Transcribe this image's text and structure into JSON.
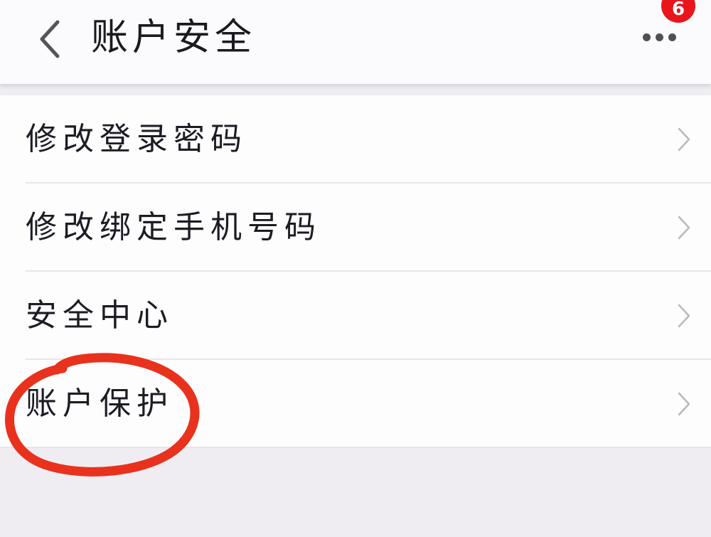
{
  "header": {
    "title": "账户安全",
    "badge_count": "6",
    "back_icon": "chevron-left-icon",
    "more_icon": "more-horizontal-icon"
  },
  "menu": {
    "items": [
      {
        "label": "修改登录密码"
      },
      {
        "label": "修改绑定手机号码"
      },
      {
        "label": "安全中心"
      },
      {
        "label": "账户保护"
      }
    ],
    "chevron_icon": "chevron-right-icon"
  },
  "annotation": {
    "color": "#e8321e",
    "target": "账户保护"
  },
  "colors": {
    "header_bg": "#fbfbfd",
    "page_bg": "#f0eef1",
    "badge": "#e8151b",
    "text": "#1c1c24",
    "chevron": "#b8b8be"
  }
}
